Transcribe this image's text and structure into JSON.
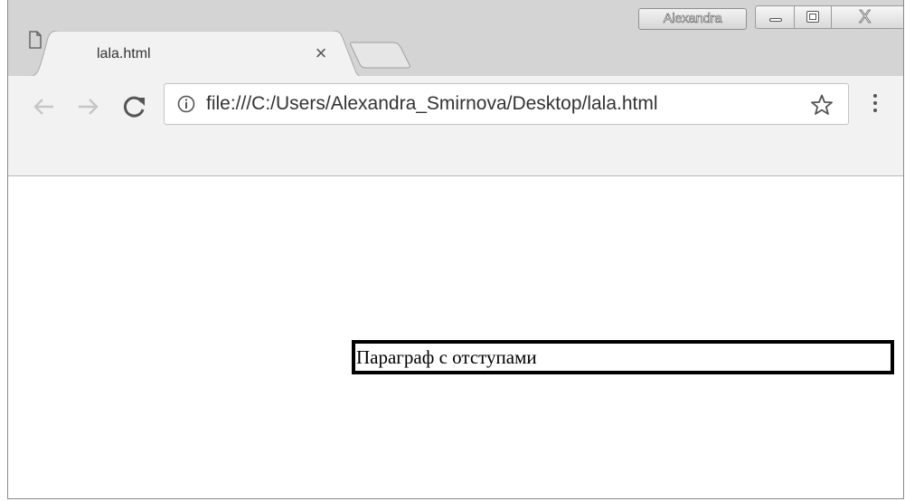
{
  "window": {
    "profile_name": "Alexandra",
    "controls": {
      "minimize": "minimize-icon",
      "maximize": "maximize-icon",
      "close_glyph": "X"
    }
  },
  "tabs": [
    {
      "title": "lala.html",
      "icon": "file-icon",
      "close": "×",
      "active": true
    }
  ],
  "toolbar": {
    "back_icon": "arrow-left-icon",
    "forward_icon": "arrow-right-icon",
    "reload_icon": "reload-icon",
    "url": "file:///C:/Users/Alexandra_Smirnova/Desktop/lala.html",
    "info_icon": "info-icon",
    "bookmark_icon": "star-icon",
    "menu_icon": "more-vertical-icon"
  },
  "page": {
    "paragraph_text": "Параграф с отступами"
  },
  "colors": {
    "titlebar": "#d4d4d4",
    "toolbar": "#f2f2f2",
    "content": "#ffffff",
    "paragraph_border": "#000000"
  }
}
